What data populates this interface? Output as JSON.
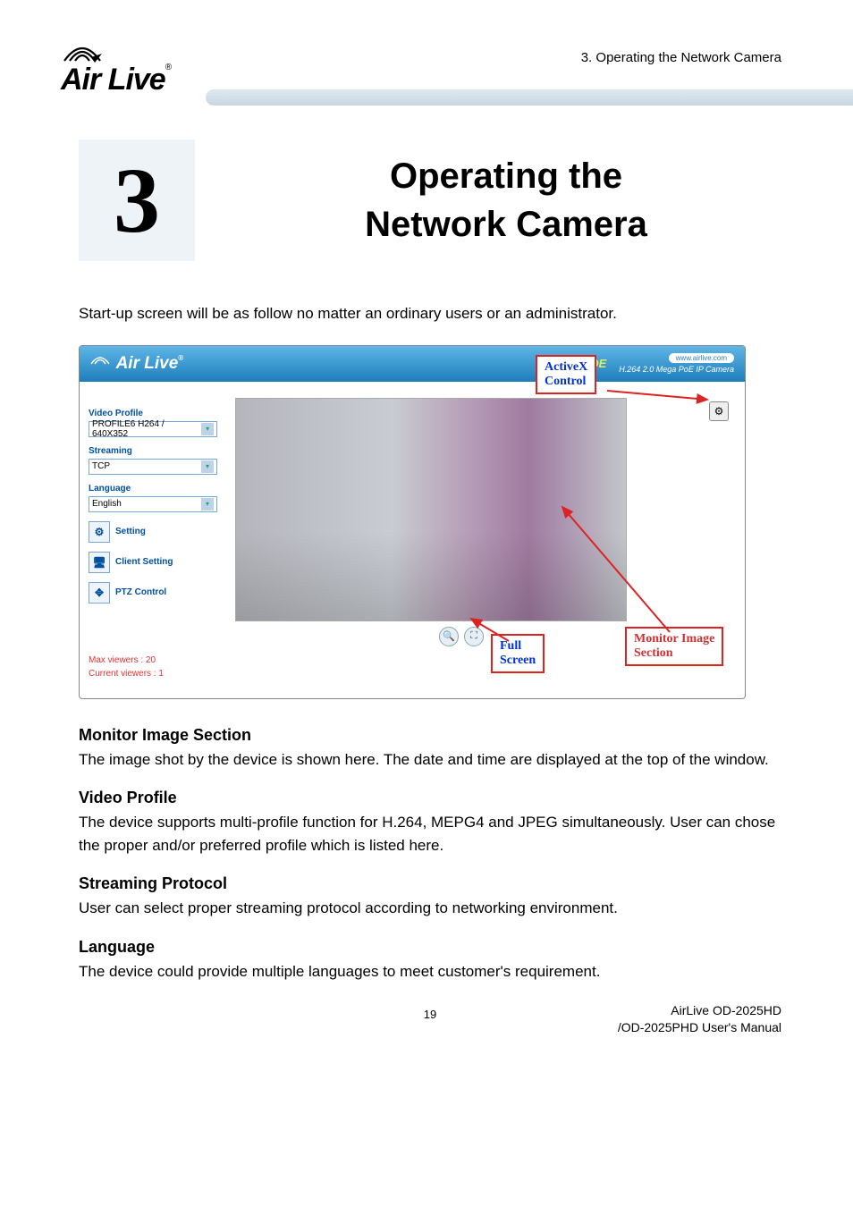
{
  "header": {
    "section_ref": "3. Operating the Network Camera",
    "logo_text": "Air Live",
    "logo_reg": "®"
  },
  "chapter": {
    "number": "3",
    "title_line1": "Operating the",
    "title_line2": "Network Camera"
  },
  "intro": "Start-up screen will be as follow no matter an ordinary users or an administrator.",
  "shot": {
    "brand": "Air Live",
    "brand_reg": "®",
    "url_pill": "www.airlive.com",
    "poe": "iPOE",
    "model": "H.264 2.0 Mega PoE IP Camera",
    "side": {
      "video_profile_label": "Video Profile",
      "video_profile_value": "PROFILE6 H264 / 640X352",
      "streaming_label": "Streaming",
      "streaming_value": "TCP",
      "language_label": "Language",
      "language_value": "English",
      "btn_setting": "Setting",
      "btn_client": "Client Setting",
      "btn_ptz": "PTZ Control",
      "max_viewers": "Max viewers : 20",
      "current_viewers": "Current viewers : 1"
    },
    "callouts": {
      "activex_l1": "ActiveX",
      "activex_l2": "Control",
      "fullscreen_l1": "Full",
      "fullscreen_l2": "Screen",
      "monitor_l1": "Monitor Image",
      "monitor_l2": "Section"
    }
  },
  "sections": {
    "monitor_h": "Monitor Image Section",
    "monitor_p": "The image shot by the device is shown here. The date and time are displayed at the top of the window.",
    "profile_h": "Video Profile",
    "profile_p": "The device supports multi-profile function for H.264, MEPG4 and JPEG simultaneously. User can chose the proper and/or preferred profile which is listed here.",
    "stream_h": "Streaming Protocol",
    "stream_p": "User can select proper streaming protocol according to networking environment.",
    "lang_h": "Language",
    "lang_p": "The device could provide multiple languages to meet customer's requirement."
  },
  "footer": {
    "page_number": "19",
    "product_l1": "AirLive OD-2025HD",
    "product_l2": "/OD-2025PHD User's Manual"
  }
}
